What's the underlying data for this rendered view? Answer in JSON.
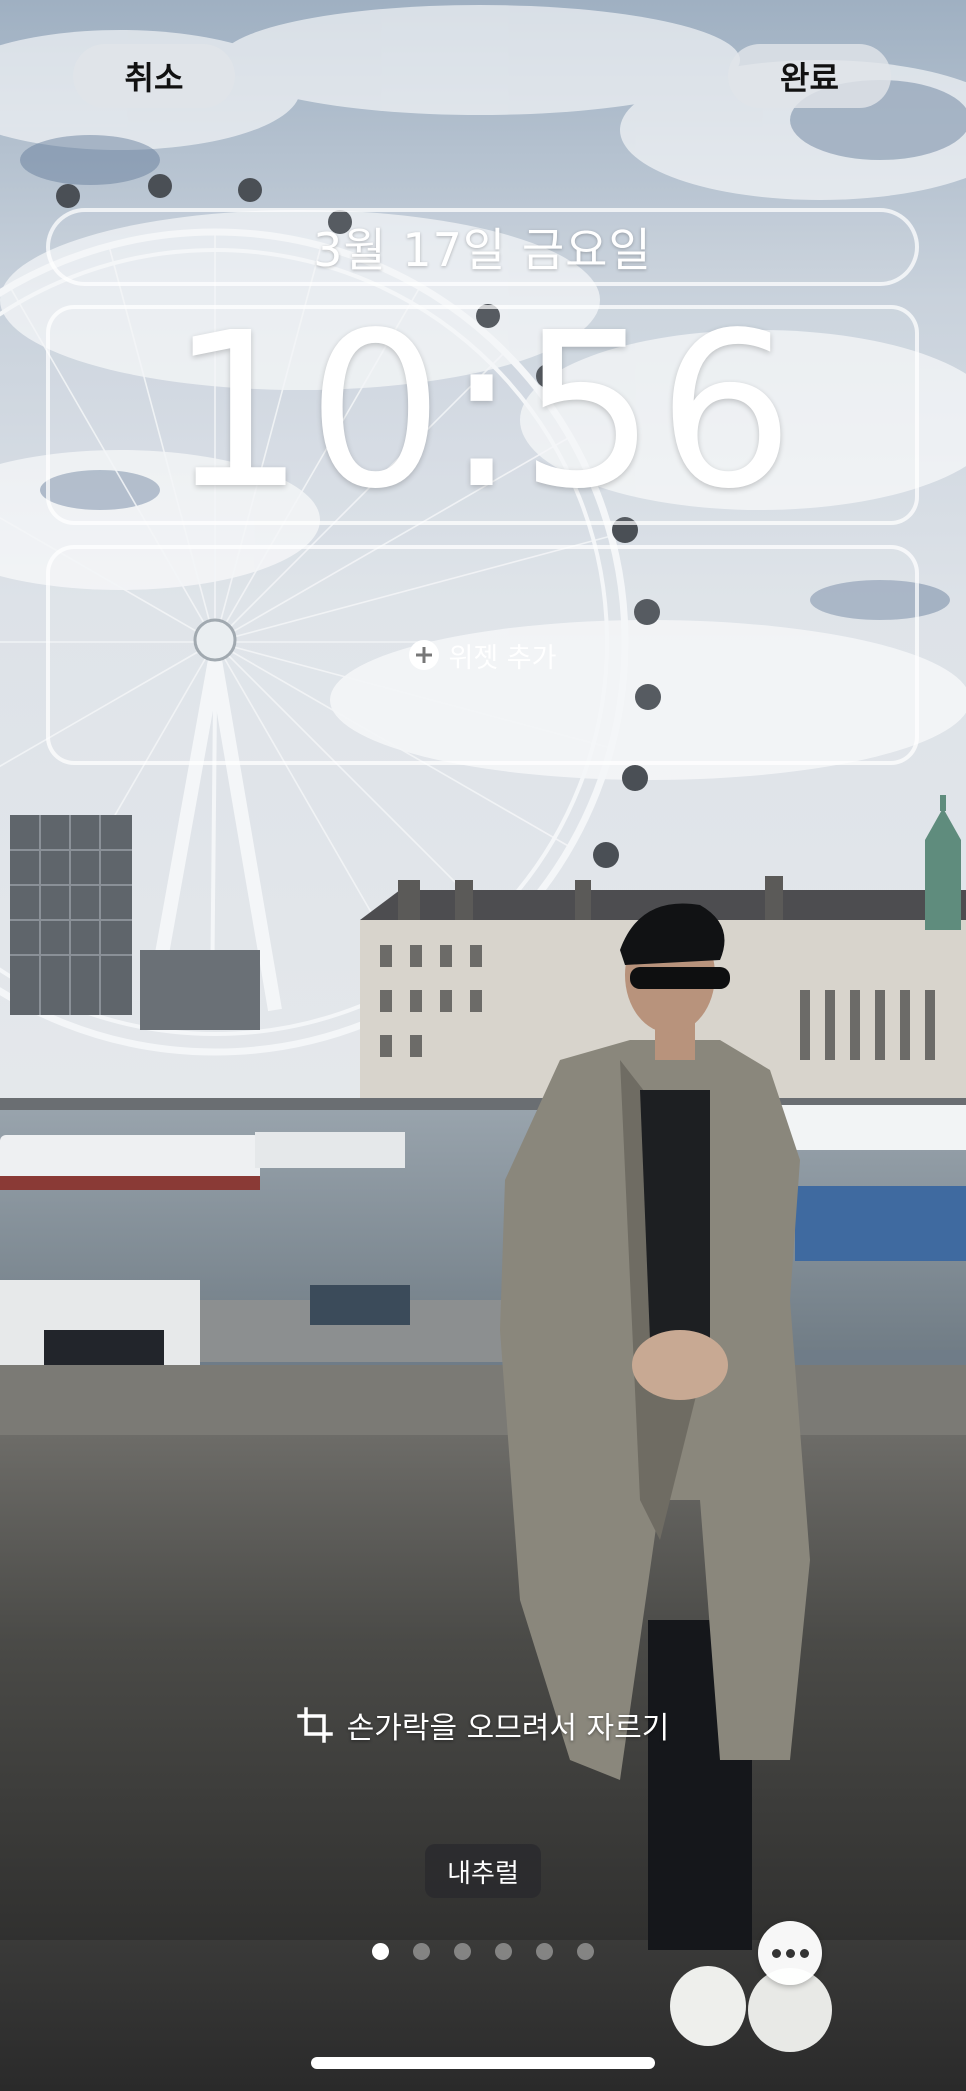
{
  "header": {
    "cancel_label": "취소",
    "done_label": "완료"
  },
  "lockscreen": {
    "date": "3월 17일 금요일",
    "time": "10:56",
    "widget_add_label": "위젯 추가"
  },
  "crop_hint": "손가락을 오므려서 자르기",
  "filter": {
    "current": "내추럴"
  },
  "pager": {
    "pages": 6,
    "active_index": 0
  },
  "icons": {
    "widget_add": "plus-circle-icon",
    "crop": "crop-icon",
    "more": "ellipsis-icon"
  }
}
